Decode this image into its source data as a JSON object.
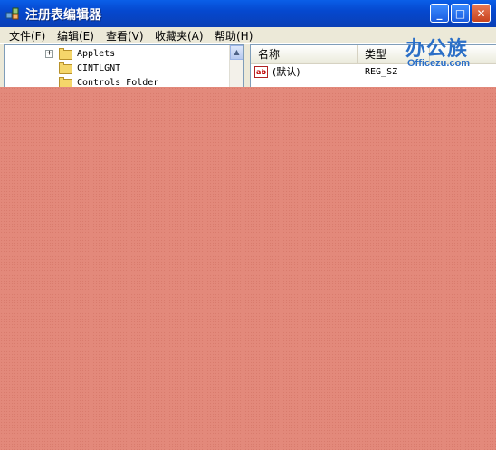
{
  "window": {
    "title": "注册表编辑器",
    "buttons": {
      "minimize": "_",
      "maximize": "□",
      "close": "✕"
    }
  },
  "menu": [
    {
      "label": "文件(F)"
    },
    {
      "label": "编辑(E)"
    },
    {
      "label": "查看(V)"
    },
    {
      "label": "收藏夹(A)"
    },
    {
      "label": "帮助(H)"
    }
  ],
  "tree": {
    "items": [
      {
        "label": "Applets",
        "expander": "+"
      },
      {
        "label": "CINTLGNT"
      },
      {
        "label": "Controls Folder"
      }
    ]
  },
  "list": {
    "columns": {
      "name": "名称",
      "type": "类型"
    },
    "rows": [
      {
        "name": "(默认)",
        "type": "REG_SZ"
      }
    ]
  },
  "watermark": {
    "cn": "办公族",
    "en": "Officezu.com"
  },
  "icons": {
    "app": "registry-editor-icon",
    "folder": "folder-icon",
    "value": "string-value-icon"
  },
  "colors": {
    "titlebar": "#0548CF",
    "overlay": "#E3897B",
    "window_bg": "#ECE9D8"
  }
}
